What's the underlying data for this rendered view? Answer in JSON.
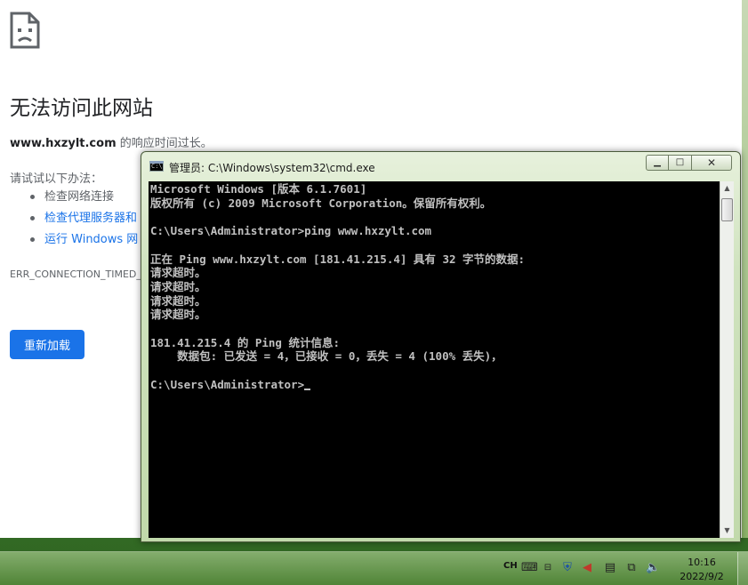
{
  "browser": {
    "error_title": "无法访问此网站",
    "error_domain": "www.hxzylt.com",
    "error_desc_suffix": " 的响应时间过长。",
    "suggest_heading": "请试试以下办法：",
    "suggestions": [
      {
        "label": "检查网络连接",
        "link": false
      },
      {
        "label": "检查代理服务器和",
        "link": true
      },
      {
        "label": "运行 Windows 网",
        "link": true
      }
    ],
    "error_code": "ERR_CONNECTION_TIMED_OUT",
    "reload_label": "重新加载"
  },
  "cmd": {
    "title": "管理员: C:\\Windows\\system32\\cmd.exe",
    "icon_label": "C:\\",
    "minimize_label": "▁",
    "maximize_label": "□",
    "close_label": "✕",
    "output": "Microsoft Windows [版本 6.1.7601]\n版权所有 (c) 2009 Microsoft Corporation。保留所有权利。\n\nC:\\Users\\Administrator>ping www.hxzylt.com\n\n正在 Ping www.hxzylt.com [181.41.215.4] 具有 32 字节的数据:\n请求超时。\n请求超时。\n请求超时。\n请求超时。\n\n181.41.215.4 的 Ping 统计信息:\n    数据包: 已发送 = 4，已接收 = 0，丢失 = 4 (100% 丢失)，\n\nC:\\Users\\Administrator>"
  },
  "taskbar": {
    "language": "CH",
    "time": "10:16",
    "date": "2022/9/2",
    "tray_icons": [
      "keyboard-icon",
      "network-pin-icon",
      "shield-icon",
      "volume-muted-icon",
      "notes-icon",
      "network-icon",
      "speaker-icon"
    ]
  },
  "colors": {
    "link": "#1a73e8",
    "button": "#1a73e8",
    "console_bg": "#000000",
    "console_text": "#c0c0c0"
  }
}
